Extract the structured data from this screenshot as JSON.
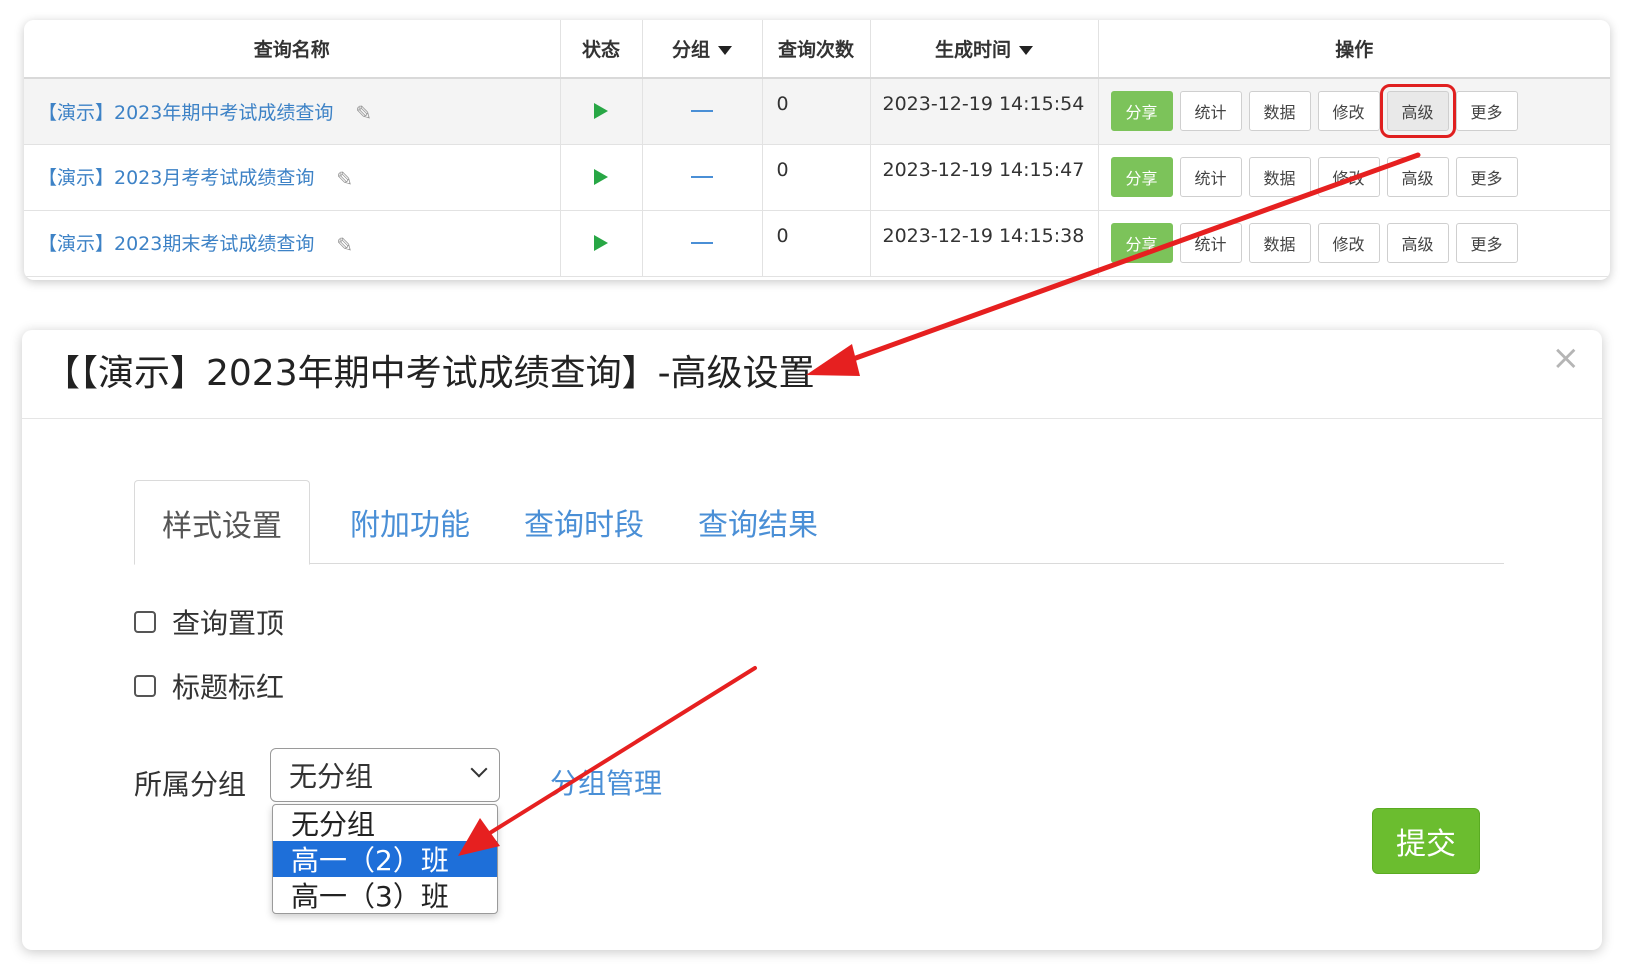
{
  "table": {
    "headers": {
      "name": "查询名称",
      "status": "状态",
      "group": "分组",
      "count": "查询次数",
      "time": "生成时间",
      "ops": "操作"
    },
    "rows": [
      {
        "name": "【演示】2023年期中考试成绩查询",
        "group": "—",
        "count": "0",
        "time": "2023-12-19 14:15:54"
      },
      {
        "name": "【演示】2023月考考试成绩查询",
        "group": "—",
        "count": "0",
        "time": "2023-12-19 14:15:47"
      },
      {
        "name": "【演示】2023期末考试成绩查询",
        "group": "—",
        "count": "0",
        "time": "2023-12-19 14:15:38"
      }
    ],
    "ops": {
      "share": "分享",
      "stats": "统计",
      "data": "数据",
      "edit": "修改",
      "advanced": "高级",
      "more": "更多"
    }
  },
  "dialog": {
    "title": "【【演示】2023年期中考试成绩查询】-高级设置",
    "close": "×",
    "tabs": [
      "样式设置",
      "附加功能",
      "查询时段",
      "查询结果"
    ],
    "checkbox_pin": "查询置顶",
    "checkbox_red": "标题标红",
    "group_label": "所属分组",
    "group_selected": "无分组",
    "group_options": [
      "无分组",
      "高一（2）班",
      "高一（3）班"
    ],
    "group_manage": "分组管理",
    "submit": "提交"
  },
  "colors": {
    "link_blue": "#3d82c6",
    "share_green": "#7cc35a",
    "submit_green": "#6bbd2f",
    "highlight_red": "#e02020",
    "option_selected_blue": "#1e6fd9"
  }
}
